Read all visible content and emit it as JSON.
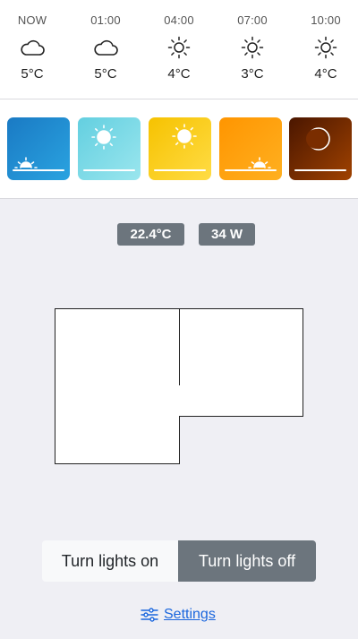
{
  "forecast": [
    {
      "time": "NOW",
      "icon": "cloud-icon",
      "temp": "5°C"
    },
    {
      "time": "01:00",
      "icon": "cloud-icon",
      "temp": "5°C"
    },
    {
      "time": "04:00",
      "icon": "sun-icon",
      "temp": "4°C"
    },
    {
      "time": "07:00",
      "icon": "sun-icon",
      "temp": "3°C"
    },
    {
      "time": "10:00",
      "icon": "sun-icon",
      "temp": "4°C"
    }
  ],
  "scenes": [
    {
      "name": "sunrise",
      "icon": "sunrise-icon",
      "colors": [
        "#1a7fc8",
        "#2ba0de"
      ]
    },
    {
      "name": "morning",
      "icon": "sun-icon",
      "colors": [
        "#6dd3e2",
        "#8fe2ec"
      ]
    },
    {
      "name": "day",
      "icon": "sun-icon",
      "colors": [
        "#f7c400",
        "#ffd93a"
      ]
    },
    {
      "name": "sunset",
      "icon": "sunset-icon",
      "colors": [
        "#ff9800",
        "#ffad20"
      ]
    },
    {
      "name": "night",
      "icon": "moon-icon",
      "colors": [
        "#5a1f00",
        "#9a3d00"
      ]
    }
  ],
  "status": {
    "temperature": "22.4°C",
    "power": "34 W"
  },
  "controls": {
    "on_label": "Turn lights on",
    "off_label": "Turn lights off"
  },
  "settings": {
    "label": "Settings",
    "icon": "sliders-icon",
    "link_color": "#1a66dd"
  },
  "colors": {
    "badge": "#6c757d",
    "active_button": "#6c757d",
    "background": "#efeff4"
  }
}
